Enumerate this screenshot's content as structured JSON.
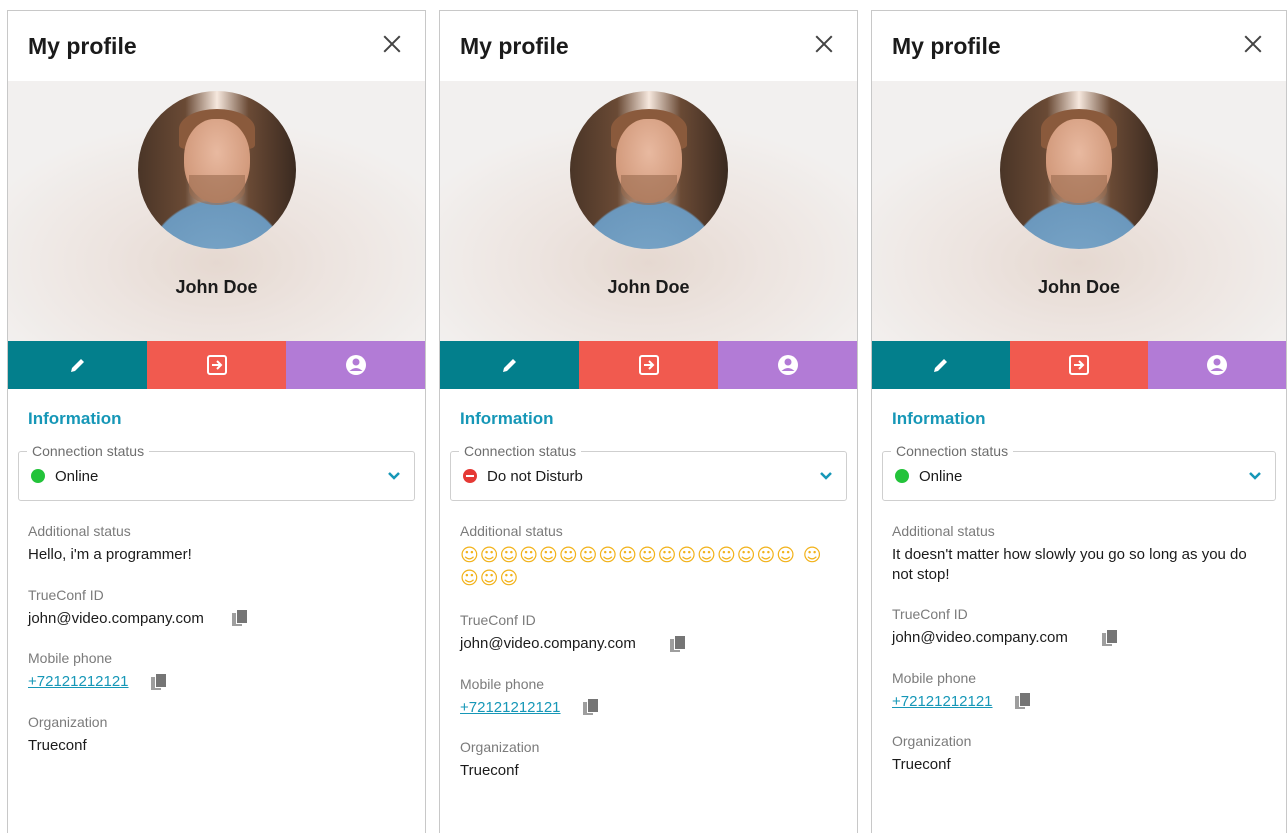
{
  "colors": {
    "accent": "#1697b7",
    "edit": "#037f8c",
    "logout": "#f15a4f",
    "account": "#b27bd6",
    "online": "#23c33a",
    "dnd": "#e53935"
  },
  "panels": [
    {
      "title": "My profile",
      "name": "John Doe",
      "info_title": "Information",
      "connection_label": "Connection status",
      "connection_value": "Online",
      "status_type": "online",
      "additional_label": "Additional status",
      "additional_value": "Hello, i'm a programmer!",
      "id_label": "TrueConf ID",
      "id_value": "john@video.company.com",
      "phone_label": "Mobile phone",
      "phone_value": "+72121212121",
      "org_label": "Organization",
      "org_value": "Trueconf"
    },
    {
      "title": "My profile",
      "name": "John Doe",
      "info_title": "Information",
      "connection_label": "Connection status",
      "connection_value": "Do not Disturb",
      "status_type": "dnd",
      "additional_label": "Additional status",
      "additional_value": "☺☺☺☺☺☺☺☺☺☺☺☺☺☺☺☺☺ ☺☺☺☺",
      "id_label": "TrueConf ID",
      "id_value": "john@video.company.com",
      "phone_label": "Mobile phone",
      "phone_value": "+72121212121",
      "org_label": "Organization",
      "org_value": "Trueconf"
    },
    {
      "title": "My profile",
      "name": "John Doe",
      "info_title": "Information",
      "connection_label": "Connection status",
      "connection_value": "Online",
      "status_type": "online",
      "additional_label": "Additional status",
      "additional_value": "It doesn't matter how slowly you go so long as you do not stop!",
      "id_label": "TrueConf ID",
      "id_value": "john@video.company.com",
      "phone_label": "Mobile phone",
      "phone_value": "+72121212121",
      "org_label": "Organization",
      "org_value": "Trueconf"
    }
  ],
  "icons": {
    "close": "close-icon",
    "edit": "pencil-icon",
    "logout": "logout-icon",
    "account": "account-icon",
    "copy": "copy-icon",
    "dropdown": "chevron-down-icon"
  }
}
